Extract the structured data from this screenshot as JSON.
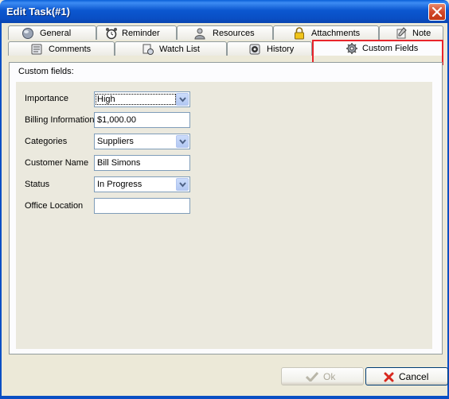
{
  "window": {
    "title": "Edit Task(#1)"
  },
  "tabs_row1": [
    {
      "label": "General",
      "icon": "globe-icon"
    },
    {
      "label": "Reminder",
      "icon": "alarm-clock-icon"
    },
    {
      "label": "Resources",
      "icon": "user-icon"
    },
    {
      "label": "Attachments",
      "icon": "padlock-icon"
    },
    {
      "label": "Note",
      "icon": "note-icon"
    }
  ],
  "tabs_row2": [
    {
      "label": "Comments",
      "icon": "comments-icon"
    },
    {
      "label": "Watch List",
      "icon": "watch-list-icon"
    },
    {
      "label": "History",
      "icon": "history-icon"
    },
    {
      "label": "Custom Fields",
      "icon": "gear-icon",
      "active": true
    }
  ],
  "panel": {
    "heading": "Custom fields:"
  },
  "fields": [
    {
      "label": "Importance",
      "type": "select",
      "value": "High"
    },
    {
      "label": "Billing Information",
      "type": "text",
      "value": "$1,000.00"
    },
    {
      "label": "Categories",
      "type": "select",
      "value": "Suppliers"
    },
    {
      "label": "Customer Name",
      "type": "text",
      "value": "Bill Simons"
    },
    {
      "label": "Status",
      "type": "select",
      "value": "In Progress"
    },
    {
      "label": "Office Location",
      "type": "text",
      "value": ""
    }
  ],
  "buttons": {
    "ok": "Ok",
    "cancel": "Cancel",
    "ok_enabled": false
  },
  "colors": {
    "title_bar": "#0a57d0",
    "highlight": "#e8242b",
    "panel_bg": "#ebe9de"
  }
}
